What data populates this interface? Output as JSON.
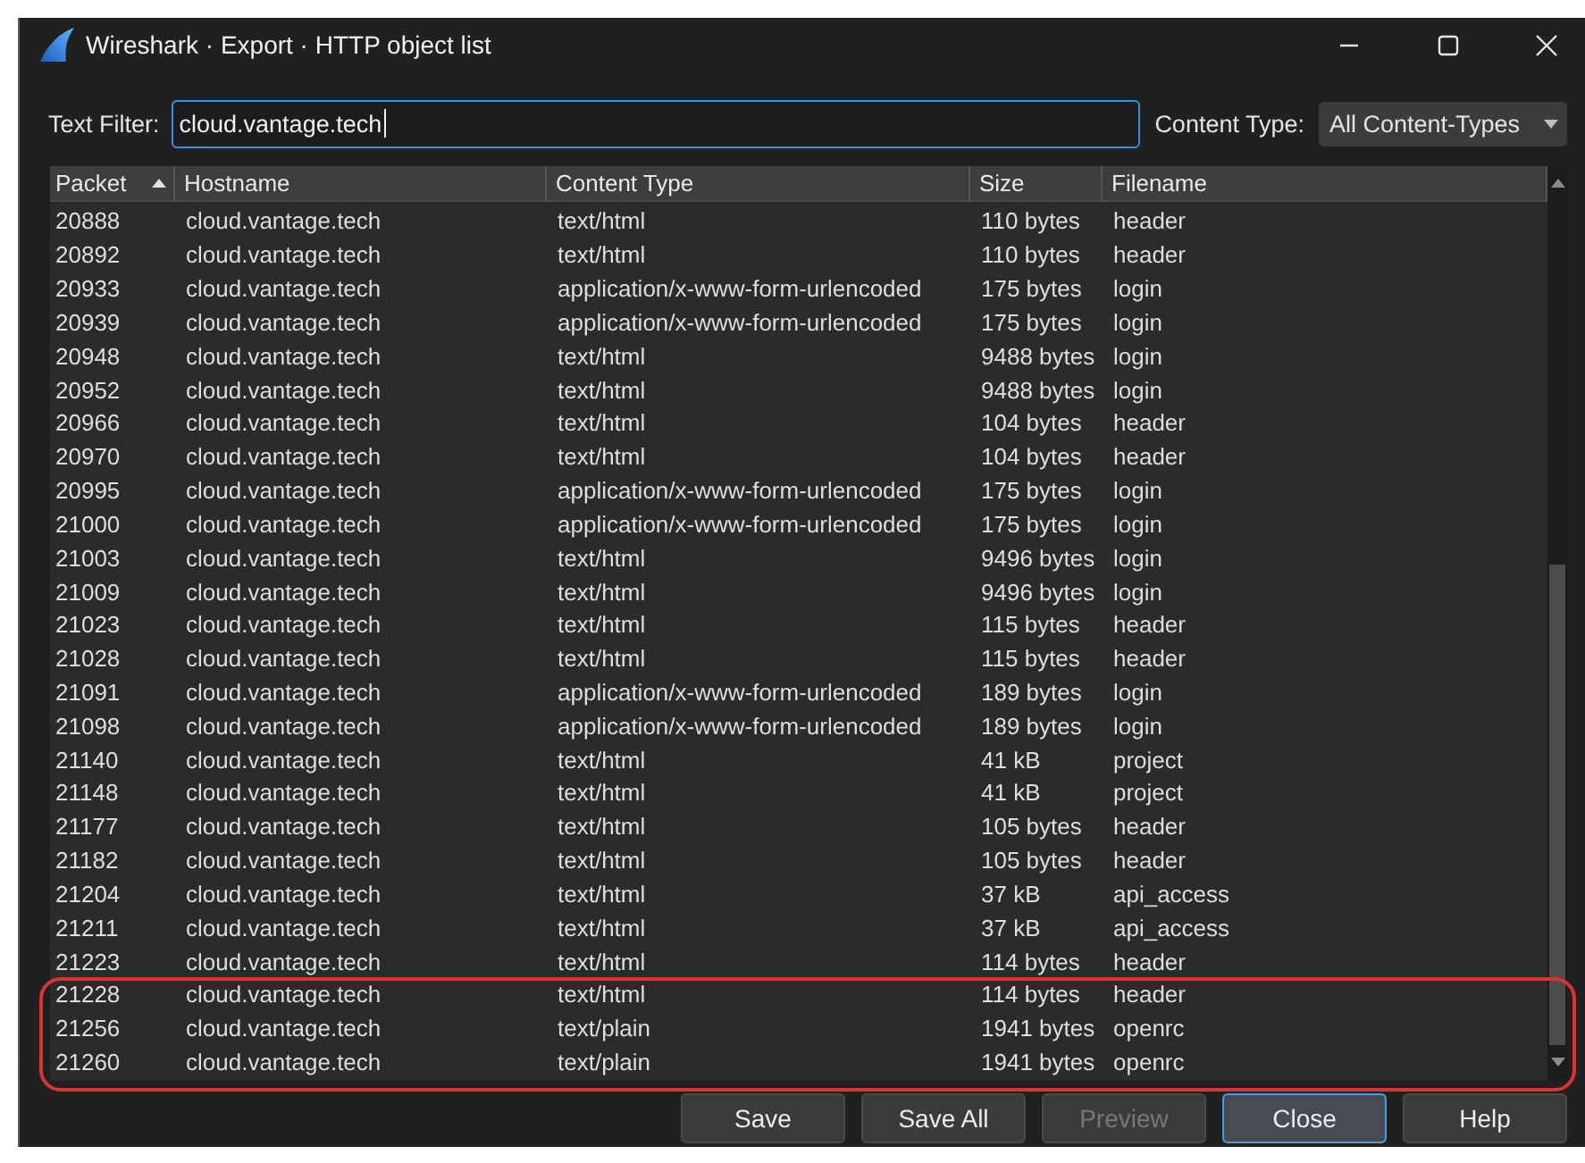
{
  "window": {
    "title": "Wireshark · Export · HTTP object list"
  },
  "filter": {
    "label": "Text Filter:",
    "value": "cloud.vantage.tech",
    "focused": true
  },
  "content_type": {
    "label": "Content Type:",
    "value": "All Content-Types"
  },
  "table": {
    "columns": [
      {
        "label": "Packet",
        "sorted": true
      },
      {
        "label": "Hostname",
        "sorted": false
      },
      {
        "label": "Content Type",
        "sorted": false
      },
      {
        "label": "Size",
        "sorted": false
      },
      {
        "label": "Filename",
        "sorted": false
      }
    ],
    "rows": [
      {
        "cells": [
          "20888",
          "cloud.vantage.tech",
          "text/html",
          "110 bytes",
          "header"
        ],
        "highlighted": false
      },
      {
        "cells": [
          "20892",
          "cloud.vantage.tech",
          "text/html",
          "110 bytes",
          "header"
        ],
        "highlighted": false
      },
      {
        "cells": [
          "20933",
          "cloud.vantage.tech",
          "application/x-www-form-urlencoded",
          "175 bytes",
          "login"
        ],
        "highlighted": false
      },
      {
        "cells": [
          "20939",
          "cloud.vantage.tech",
          "application/x-www-form-urlencoded",
          "175 bytes",
          "login"
        ],
        "highlighted": false
      },
      {
        "cells": [
          "20948",
          "cloud.vantage.tech",
          "text/html",
          "9488 bytes",
          "login"
        ],
        "highlighted": false
      },
      {
        "cells": [
          "20952",
          "cloud.vantage.tech",
          "text/html",
          "9488 bytes",
          "login"
        ],
        "highlighted": false
      },
      {
        "cells": [
          "20966",
          "cloud.vantage.tech",
          "text/html",
          "104 bytes",
          "header"
        ],
        "highlighted": false
      },
      {
        "cells": [
          "20970",
          "cloud.vantage.tech",
          "text/html",
          "104 bytes",
          "header"
        ],
        "highlighted": false
      },
      {
        "cells": [
          "20995",
          "cloud.vantage.tech",
          "application/x-www-form-urlencoded",
          "175 bytes",
          "login"
        ],
        "highlighted": false
      },
      {
        "cells": [
          "21000",
          "cloud.vantage.tech",
          "application/x-www-form-urlencoded",
          "175 bytes",
          "login"
        ],
        "highlighted": false
      },
      {
        "cells": [
          "21003",
          "cloud.vantage.tech",
          "text/html",
          "9496 bytes",
          "login"
        ],
        "highlighted": false
      },
      {
        "cells": [
          "21009",
          "cloud.vantage.tech",
          "text/html",
          "9496 bytes",
          "login"
        ],
        "highlighted": false
      },
      {
        "cells": [
          "21023",
          "cloud.vantage.tech",
          "text/html",
          "115 bytes",
          "header"
        ],
        "highlighted": false
      },
      {
        "cells": [
          "21028",
          "cloud.vantage.tech",
          "text/html",
          "115 bytes",
          "header"
        ],
        "highlighted": false
      },
      {
        "cells": [
          "21091",
          "cloud.vantage.tech",
          "application/x-www-form-urlencoded",
          "189 bytes",
          "login"
        ],
        "highlighted": false
      },
      {
        "cells": [
          "21098",
          "cloud.vantage.tech",
          "application/x-www-form-urlencoded",
          "189 bytes",
          "login"
        ],
        "highlighted": false
      },
      {
        "cells": [
          "21140",
          "cloud.vantage.tech",
          "text/html",
          "41 kB",
          "project"
        ],
        "highlighted": false
      },
      {
        "cells": [
          "21148",
          "cloud.vantage.tech",
          "text/html",
          "41 kB",
          "project"
        ],
        "highlighted": false
      },
      {
        "cells": [
          "21177",
          "cloud.vantage.tech",
          "text/html",
          "105 bytes",
          "header"
        ],
        "highlighted": false
      },
      {
        "cells": [
          "21182",
          "cloud.vantage.tech",
          "text/html",
          "105 bytes",
          "header"
        ],
        "highlighted": false
      },
      {
        "cells": [
          "21204",
          "cloud.vantage.tech",
          "text/html",
          "37 kB",
          "api_access"
        ],
        "highlighted": false
      },
      {
        "cells": [
          "21211",
          "cloud.vantage.tech",
          "text/html",
          "37 kB",
          "api_access"
        ],
        "highlighted": false
      },
      {
        "cells": [
          "21223",
          "cloud.vantage.tech",
          "text/html",
          "114 bytes",
          "header"
        ],
        "highlighted": false
      },
      {
        "cells": [
          "21228",
          "cloud.vantage.tech",
          "text/html",
          "114 bytes",
          "header"
        ],
        "highlighted": true
      },
      {
        "cells": [
          "21256",
          "cloud.vantage.tech",
          "text/plain",
          "1941 bytes",
          "openrc"
        ],
        "highlighted": true
      },
      {
        "cells": [
          "21260",
          "cloud.vantage.tech",
          "text/plain",
          "1941 bytes",
          "openrc"
        ],
        "highlighted": true
      }
    ]
  },
  "buttons": [
    {
      "label": "Save",
      "disabled": false,
      "focused": false
    },
    {
      "label": "Save All",
      "disabled": false,
      "focused": false
    },
    {
      "label": "Preview",
      "disabled": true,
      "focused": false
    },
    {
      "label": "Close",
      "disabled": false,
      "focused": true
    },
    {
      "label": "Help",
      "disabled": false,
      "focused": false
    }
  ]
}
